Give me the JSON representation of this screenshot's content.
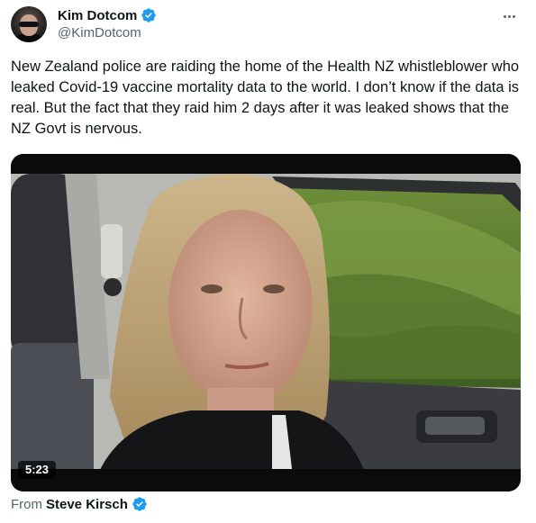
{
  "author": {
    "display_name": "Kim Dotcom",
    "handle": "@KimDotcom",
    "verified_color": "#1d9bf0"
  },
  "tweet": {
    "text": "New Zealand police are raiding the home of the Health NZ whistleblower who leaked Covid-19 vaccine mortality data to the world. I don’t know if the data is real. But the fact that they raid him 2 days after it was leaked shows that the NZ Govt is nervous."
  },
  "media": {
    "duration": "5:23"
  },
  "attribution": {
    "label": "From",
    "source_name": "Steve Kirsch"
  },
  "icons": {
    "more": "more-horizontal-icon",
    "verified": "verified-badge-icon"
  }
}
